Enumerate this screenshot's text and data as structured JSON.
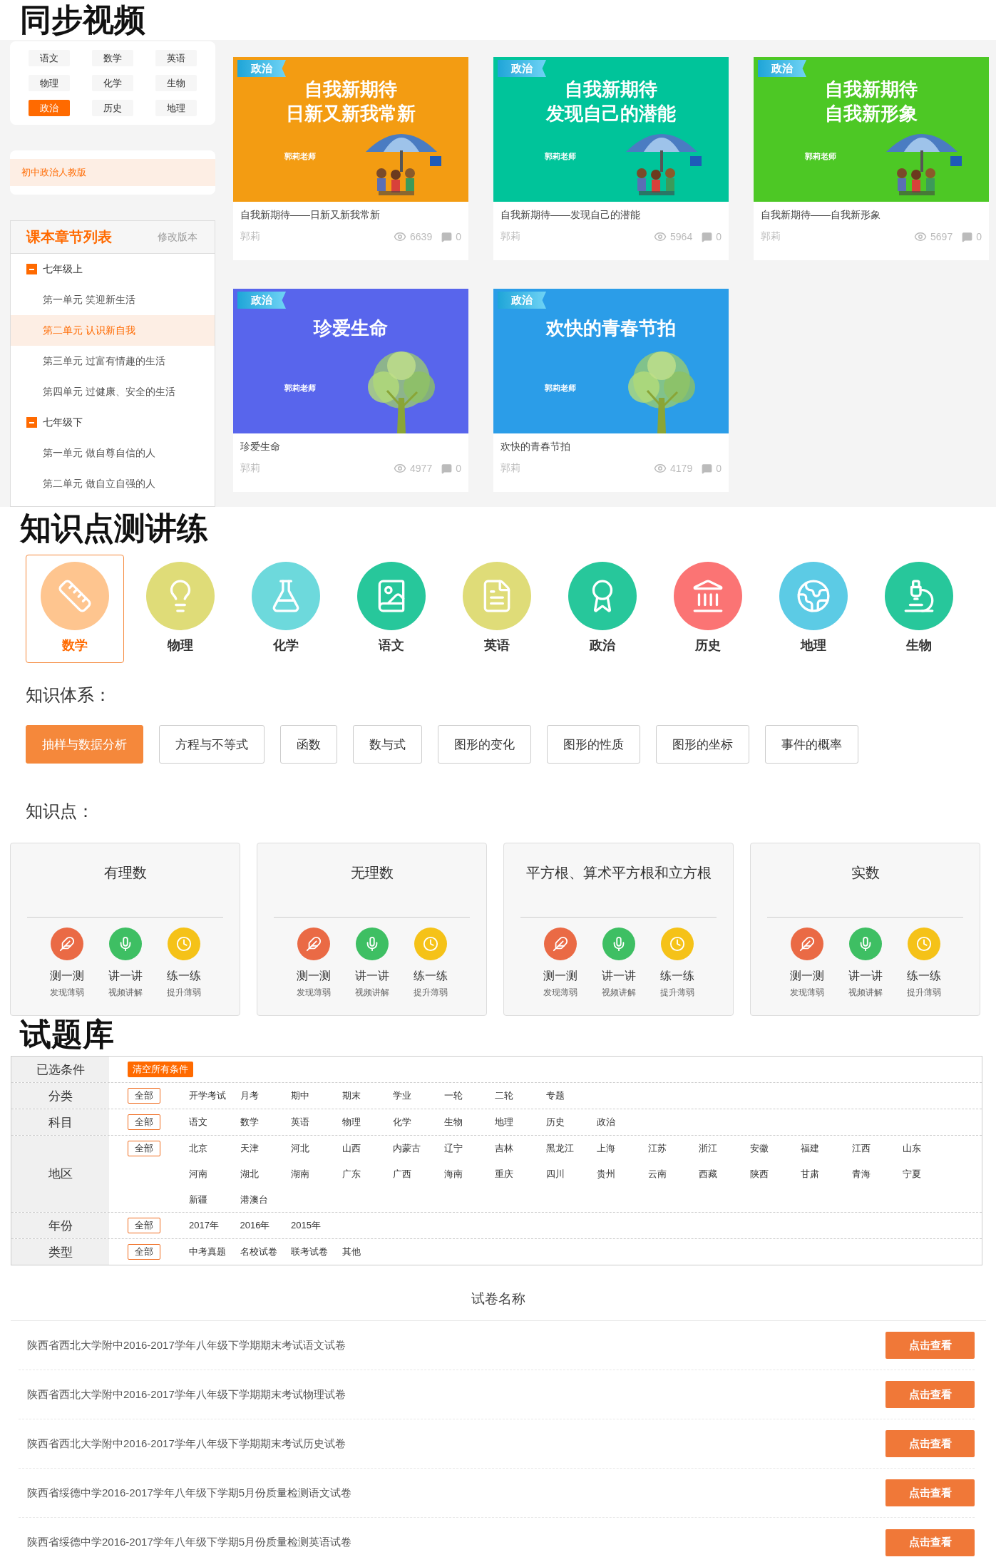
{
  "sync_videos": {
    "title": "同步视频",
    "subjects": [
      {
        "label": "语文",
        "selected": false
      },
      {
        "label": "数学",
        "selected": false
      },
      {
        "label": "英语",
        "selected": false
      },
      {
        "label": "物理",
        "selected": false
      },
      {
        "label": "化学",
        "selected": false
      },
      {
        "label": "生物",
        "selected": false
      },
      {
        "label": "政治",
        "selected": true
      },
      {
        "label": "历史",
        "selected": false
      },
      {
        "label": "地理",
        "selected": false
      }
    ],
    "version": "初中政治人教版",
    "chapters": {
      "title": "课本章节列表",
      "edit_link": "修改版本",
      "groups": [
        {
          "label": "七年级上",
          "expanded": true,
          "children": [
            {
              "label": "第一单元 笑迎新生活",
              "selected": false
            },
            {
              "label": "第二单元 认识新自我",
              "selected": true
            },
            {
              "label": "第三单元 过富有情趣的生活",
              "selected": false
            },
            {
              "label": "第四单元 过健康、安全的生活",
              "selected": false
            }
          ]
        },
        {
          "label": "七年级下",
          "expanded": true,
          "children": [
            {
              "label": "第一单元 做自尊自信的人",
              "selected": false
            },
            {
              "label": "第二单元 做自立自强的人",
              "selected": false
            }
          ]
        }
      ]
    },
    "videos": [
      {
        "badge": "政治",
        "headline": [
          "自我新期待",
          "日新又新我常新"
        ],
        "teacher": "郭莉老师",
        "kind": "umbrella",
        "color": "#f39c12",
        "title": "自我新期待——日新又新我常新",
        "author": "郭莉",
        "views": "6639",
        "comments": "0"
      },
      {
        "badge": "政治",
        "headline": [
          "自我新期待",
          "发现自己的潜能"
        ],
        "teacher": "郭莉老师",
        "kind": "umbrella",
        "color": "#00c49a",
        "title": "自我新期待——发现自己的潜能",
        "author": "郭莉",
        "views": "5964",
        "comments": "0"
      },
      {
        "badge": "政治",
        "headline": [
          "自我新期待",
          "自我新形象"
        ],
        "teacher": "郭莉老师",
        "kind": "umbrella",
        "color": "#4dc825",
        "title": "自我新期待——自我新形象",
        "author": "郭莉",
        "views": "5697",
        "comments": "0"
      },
      {
        "badge": "政治",
        "headline": [
          "珍爱生命"
        ],
        "teacher": "郭莉老师",
        "kind": "tree",
        "color": "#5865ec",
        "title": "珍爱生命",
        "author": "郭莉",
        "views": "4977",
        "comments": "0"
      },
      {
        "badge": "政治",
        "headline": [
          "欢快的青春节拍"
        ],
        "teacher": "郭莉老师",
        "kind": "tree",
        "color": "#2b9de8",
        "title": "欢快的青春节拍",
        "author": "郭莉",
        "views": "4179",
        "comments": "0"
      }
    ]
  },
  "knowledge": {
    "title": "知识点测讲练",
    "subjects": [
      {
        "label": "数学",
        "color": "#fec58f",
        "selected": true
      },
      {
        "label": "物理",
        "color": "#dfdc78",
        "selected": false
      },
      {
        "label": "化学",
        "color": "#6dd9dc",
        "selected": false
      },
      {
        "label": "语文",
        "color": "#27c79b",
        "selected": false
      },
      {
        "label": "英语",
        "color": "#dfdc78",
        "selected": false
      },
      {
        "label": "政治",
        "color": "#27c79b",
        "selected": false
      },
      {
        "label": "历史",
        "color": "#fb7474",
        "selected": false
      },
      {
        "label": "地理",
        "color": "#5ccbe5",
        "selected": false
      },
      {
        "label": "生物",
        "color": "#27c79b",
        "selected": false
      }
    ],
    "system_label": "知识体系：",
    "topics": [
      {
        "label": "抽样与数据分析",
        "selected": true
      },
      {
        "label": "方程与不等式",
        "selected": false
      },
      {
        "label": "函数",
        "selected": false
      },
      {
        "label": "数与式",
        "selected": false
      },
      {
        "label": "图形的变化",
        "selected": false
      },
      {
        "label": "图形的性质",
        "selected": false
      },
      {
        "label": "图形的坐标",
        "selected": false
      },
      {
        "label": "事件的概率",
        "selected": false
      }
    ],
    "points_label": "知识点：",
    "points": [
      {
        "title": "有理数",
        "actions": [
          {
            "label": "测一测",
            "sub": "发现薄弱",
            "color": "#ea6a45"
          },
          {
            "label": "讲一讲",
            "sub": "视频讲解",
            "color": "#3ebf63"
          },
          {
            "label": "练一练",
            "sub": "提升薄弱",
            "color": "#f5c218"
          }
        ]
      },
      {
        "title": "无理数",
        "actions": [
          {
            "label": "测一测",
            "sub": "发现薄弱",
            "color": "#ea6a45"
          },
          {
            "label": "讲一讲",
            "sub": "视频讲解",
            "color": "#3ebf63"
          },
          {
            "label": "练一练",
            "sub": "提升薄弱",
            "color": "#f5c218"
          }
        ]
      },
      {
        "title": "平方根、算术平方根和立方根",
        "actions": [
          {
            "label": "测一测",
            "sub": "发现薄弱",
            "color": "#ea6a45"
          },
          {
            "label": "讲一讲",
            "sub": "视频讲解",
            "color": "#3ebf63"
          },
          {
            "label": "练一练",
            "sub": "提升薄弱",
            "color": "#f5c218"
          }
        ]
      },
      {
        "title": "实数",
        "actions": [
          {
            "label": "测一测",
            "sub": "发现薄弱",
            "color": "#ea6a45"
          },
          {
            "label": "讲一讲",
            "sub": "视频讲解",
            "color": "#3ebf63"
          },
          {
            "label": "练一练",
            "sub": "提升薄弱",
            "color": "#f5c218"
          }
        ]
      }
    ]
  },
  "question_bank": {
    "title": "试题库",
    "filters": [
      {
        "label": "已选条件",
        "kind": "clear",
        "button": "清空所有条件"
      },
      {
        "label": "分类",
        "kind": "options",
        "all": {
          "label": "全部",
          "selected": true
        },
        "options": [
          "开学考试",
          "月考",
          "期中",
          "期末",
          "学业",
          "一轮",
          "二轮",
          "专题"
        ]
      },
      {
        "label": "科目",
        "kind": "options",
        "all": {
          "label": "全部",
          "selected": true
        },
        "options": [
          "语文",
          "数学",
          "英语",
          "物理",
          "化学",
          "生物",
          "地理",
          "历史",
          "政治"
        ]
      },
      {
        "label": "地区",
        "kind": "options",
        "all": {
          "label": "全部",
          "selected": true
        },
        "options": [
          "北京",
          "天津",
          "河北",
          "山西",
          "内蒙古",
          "辽宁",
          "吉林",
          "黑龙江",
          "上海",
          "江苏",
          "浙江",
          "安徽",
          "福建",
          "江西",
          "山东",
          "河南",
          "湖北",
          "湖南",
          "广东",
          "广西",
          "海南",
          "重庆",
          "四川",
          "贵州",
          "云南",
          "西藏",
          "陕西",
          "甘肃",
          "青海",
          "宁夏",
          "新疆",
          "港澳台"
        ]
      },
      {
        "label": "年份",
        "kind": "options",
        "all": {
          "label": "全部",
          "selected": true
        },
        "options": [
          "2017年",
          "2016年",
          "2015年"
        ]
      },
      {
        "label": "类型",
        "kind": "options",
        "all": {
          "label": "全部",
          "selected": true
        },
        "options": [
          "中考真题",
          "名校试卷",
          "联考试卷",
          "其他"
        ]
      }
    ],
    "list_header": "试卷名称",
    "papers": [
      {
        "title": "陕西省西北大学附中2016-2017学年八年级下学期期末考试语文试卷",
        "button": "点击查看"
      },
      {
        "title": "陕西省西北大学附中2016-2017学年八年级下学期期末考试物理试卷",
        "button": "点击查看"
      },
      {
        "title": "陕西省西北大学附中2016-2017学年八年级下学期期末考试历史试卷",
        "button": "点击查看"
      },
      {
        "title": "陕西省绥德中学2016-2017学年八年级下学期5月份质量检测语文试卷",
        "button": "点击查看"
      },
      {
        "title": "陕西省绥德中学2016-2017学年八年级下学期5月份质量检测英语试卷",
        "button": "点击查看"
      }
    ]
  }
}
